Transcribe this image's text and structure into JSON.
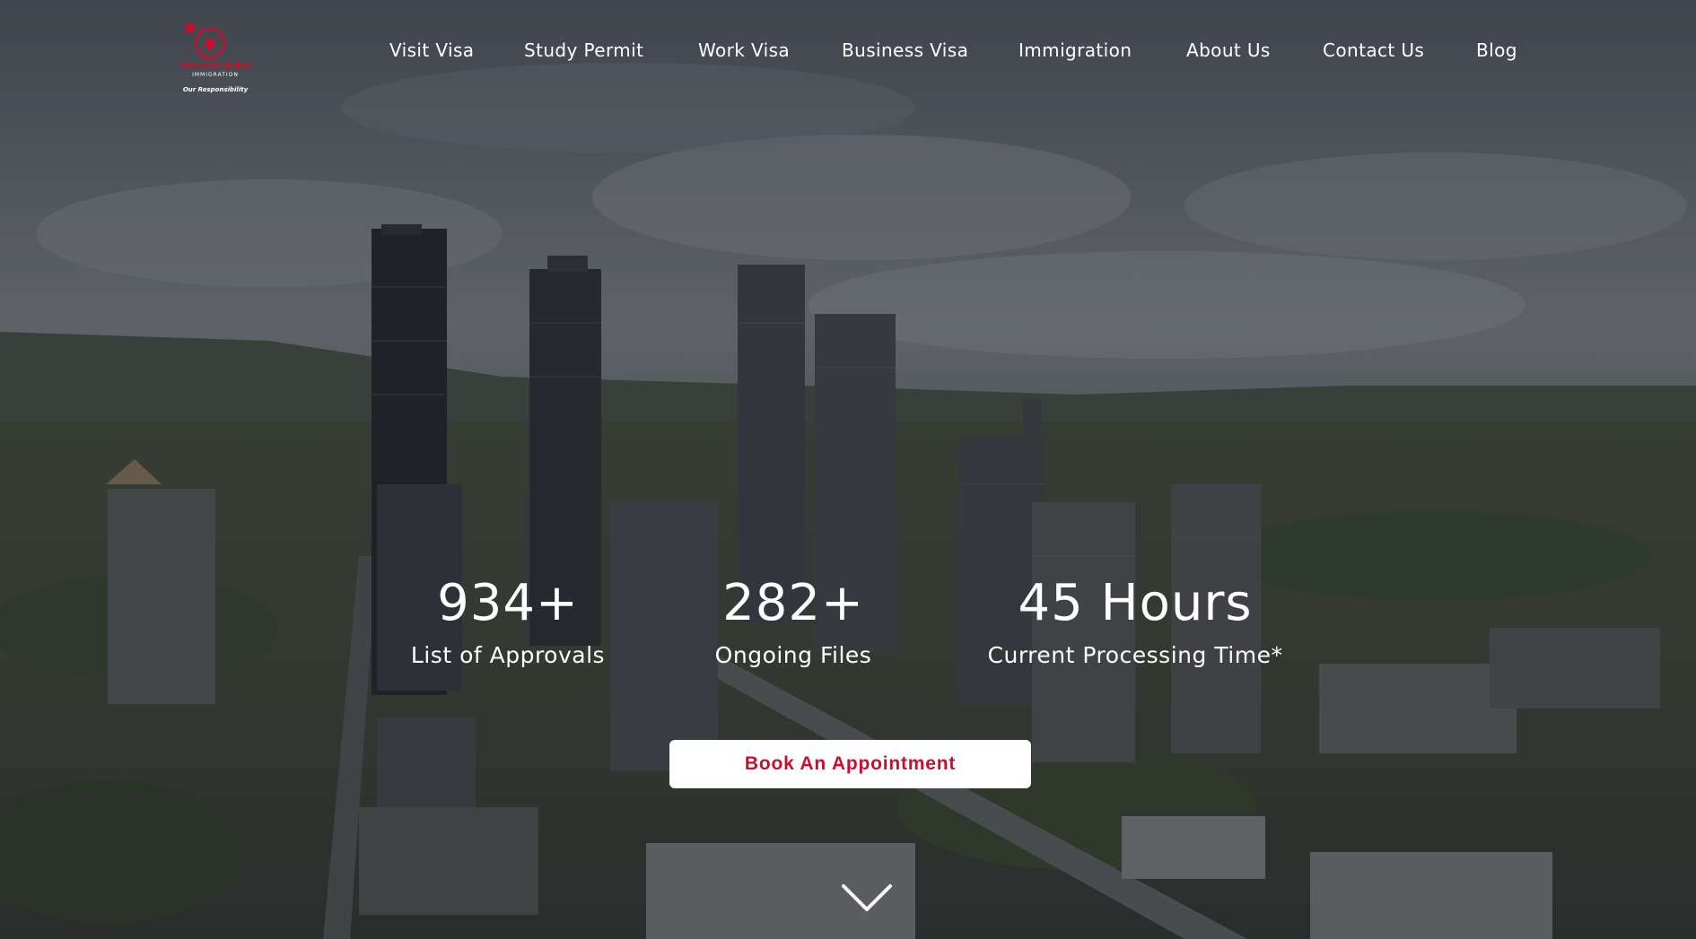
{
  "brand": {
    "name": "GROWING GL●BE",
    "sub": "IMMIGRATION",
    "tagline": "Our Responsibility",
    "colors": {
      "accent": "#c8102e",
      "text": "#ffffff"
    }
  },
  "nav": {
    "items": [
      {
        "label": "Visit Visa"
      },
      {
        "label": "Study Permit"
      },
      {
        "label": "Work Visa"
      },
      {
        "label": "Business Visa"
      },
      {
        "label": "Immigration"
      },
      {
        "label": "About Us"
      },
      {
        "label": "Contact Us"
      },
      {
        "label": "Blog"
      }
    ]
  },
  "stats": [
    {
      "value": "934+",
      "label": "List of Approvals"
    },
    {
      "value": "282+",
      "label": "Ongoing Files"
    },
    {
      "value": "45 Hours",
      "label": "Current Processing Time*"
    }
  ],
  "cta": {
    "label": "Book An Appointment"
  },
  "icons": {
    "scroll": "chevron-down-icon",
    "logo": "maple-leaf-globe-icon"
  }
}
